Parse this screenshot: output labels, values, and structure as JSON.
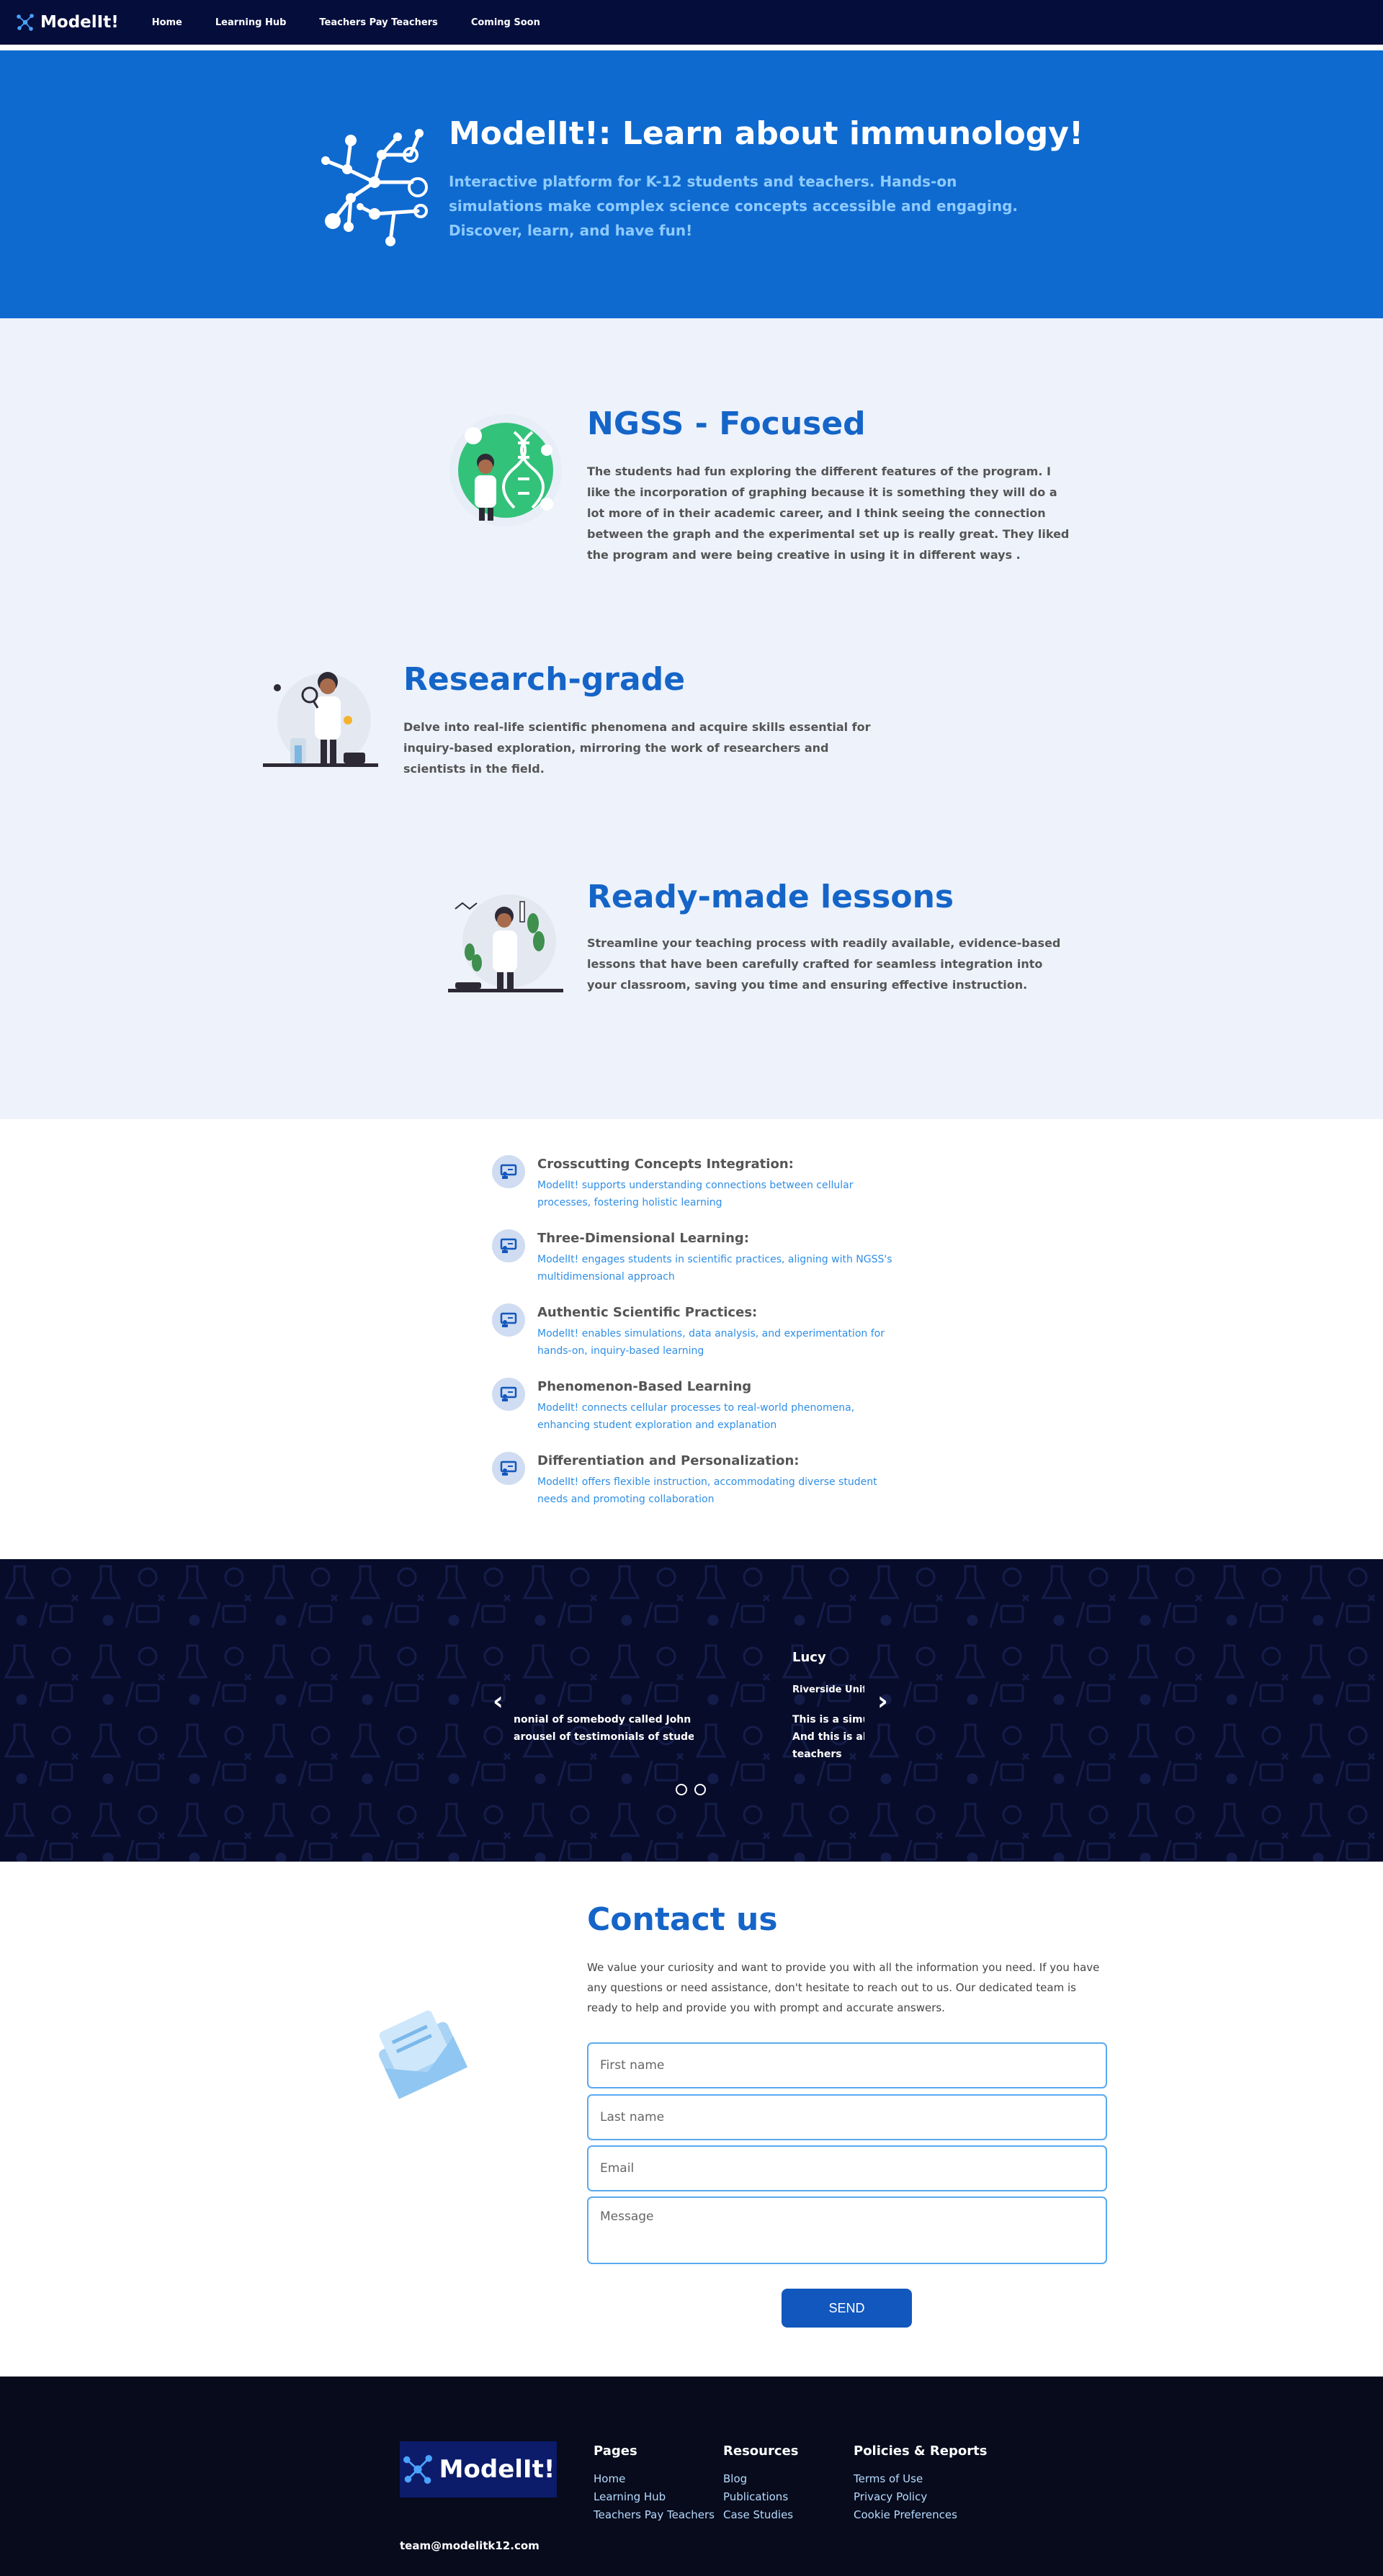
{
  "nav": {
    "logo": "ModelIt!",
    "links": [
      "Home",
      "Learning Hub",
      "Teachers Pay Teachers",
      "Coming Soon"
    ]
  },
  "hero": {
    "title": "ModelIt!: Learn about immunology!",
    "subtitle": "Interactive platform for K-12 students and teachers. Hands-on simulations make complex science concepts accessible and engaging. Discover, learn, and have fun!"
  },
  "features": [
    {
      "title": "NGSS - Focused",
      "text": "The students had fun exploring the different features of the program. I like the incorporation of graphing because it is something they will do a lot more of in their academic career, and I think seeing the connection between the graph and the experimental set up is really great. They liked the program and were being creative in using it in different ways ."
    },
    {
      "title": "Research-grade",
      "text": "Delve into real-life scientific phenomena and acquire skills essential for inquiry-based exploration, mirroring the work of researchers and scientists in the field."
    },
    {
      "title": "Ready-made lessons",
      "text": "Streamline your teaching process with readily available, evidence-based lessons that have been carefully crafted for seamless integration into your classroom, saving you time and ensuring effective instruction."
    }
  ],
  "checklist": [
    {
      "head": "Crosscutting Concepts Integration:",
      "desc": "ModelIt! supports understanding connections between cellular processes, fostering holistic learning"
    },
    {
      "head": "Three-Dimensional Learning:",
      "desc": "ModelIt! engages students in scientific practices, aligning with NGSS's multidimensional approach"
    },
    {
      "head": "Authentic Scientific Practices:",
      "desc": "ModelIt! enables simulations, data analysis, and experimentation for hands-on, inquiry-based learning"
    },
    {
      "head": "Phenomenon-Based Learning",
      "desc": "ModelIt! connects cellular processes to real-world phenomena, enhancing student exploration and explanation"
    },
    {
      "head": "Differentiation and Personalization:",
      "desc": "ModelIt! offers flexible instruction, accommodating diverse student needs and promoting collaboration"
    }
  ],
  "testimonials": {
    "left_line1": "nonial of somebody called John",
    "left_line2": "arousel of testimonials of students",
    "right_name": "Lucy",
    "right_org": "Riverside Unifi",
    "right_line1": "This is a simula",
    "right_line2": "And this is also",
    "right_line3": "teachers",
    "prev": "‹",
    "next": "›"
  },
  "contact": {
    "title": "Contact us",
    "text": "We value your curiosity and want to provide you with all the information you need. If you have any questions or need assistance, don't hesitate to reach out to us. Our dedicated team is ready to help and provide you with prompt and accurate answers.",
    "first_name": "First name",
    "last_name": "Last name",
    "email": "Email",
    "message": "Message",
    "send": "SEND"
  },
  "footer": {
    "logo": "ModelIt!",
    "email": "team@modelitk12.com",
    "columns": [
      {
        "head": "Pages",
        "links": [
          "Home",
          "Learning Hub",
          "Teachers Pay Teachers"
        ]
      },
      {
        "head": "Resources",
        "links": [
          "Blog",
          "Publications",
          "Case Studies"
        ]
      },
      {
        "head": "Policies & Reports",
        "links": [
          "Terms of Use",
          "Privacy Policy",
          "Cookie Preferences"
        ]
      }
    ]
  },
  "colors": {
    "nav_bg": "#050d3b",
    "hero_bg": "#0f6ad0",
    "accent": "#1565c8",
    "features_bg": "#edf2fb",
    "testimonial_bg": "#070c2a",
    "footer_bg": "#070b1c",
    "button": "#1257bd"
  },
  "icons": [
    "molecule-icon",
    "presentation-icon",
    "envelope-icon",
    "chevron-left-icon",
    "chevron-right-icon"
  ]
}
